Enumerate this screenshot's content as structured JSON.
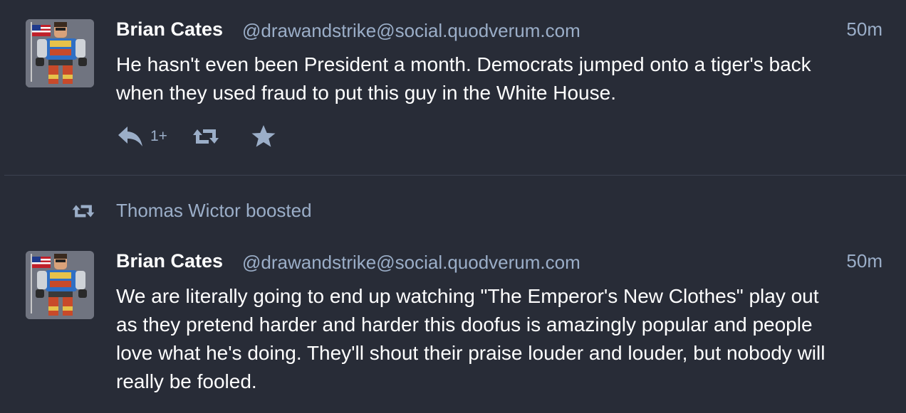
{
  "statuses": [
    {
      "display_name": "Brian Cates",
      "account": "@drawandstrike@social.quodverum.com",
      "time": "50m",
      "content_lines": [
        "He hasn't even been President a month.  Democrats jumped onto a tiger's back",
        "when they used fraud to put this guy in the White House."
      ],
      "reply_count": "1+",
      "avatar_icon": "action-figure-avatar",
      "icons": {
        "reply": "reply-icon",
        "boost": "boost-icon",
        "favourite": "star-icon"
      }
    },
    {
      "display_name": "Brian Cates",
      "account": "@drawandstrike@social.quodverum.com",
      "time": "50m",
      "content_lines": [
        "We are literally going to end up watching \"The Emperor's New Clothes\" play out",
        "as they pretend harder and harder this doofus is amazingly popular and people",
        "love what he's doing. They'll shout their praise louder and louder, but nobody will",
        "really be fooled."
      ],
      "avatar_icon": "action-figure-avatar"
    }
  ],
  "boost_line": {
    "text": "Thomas Wictor boosted",
    "icon": "boost-icon"
  },
  "colors": {
    "background": "#282c37",
    "text": "#ffffff",
    "muted": "#9baec8",
    "divider": "#3c4150"
  }
}
